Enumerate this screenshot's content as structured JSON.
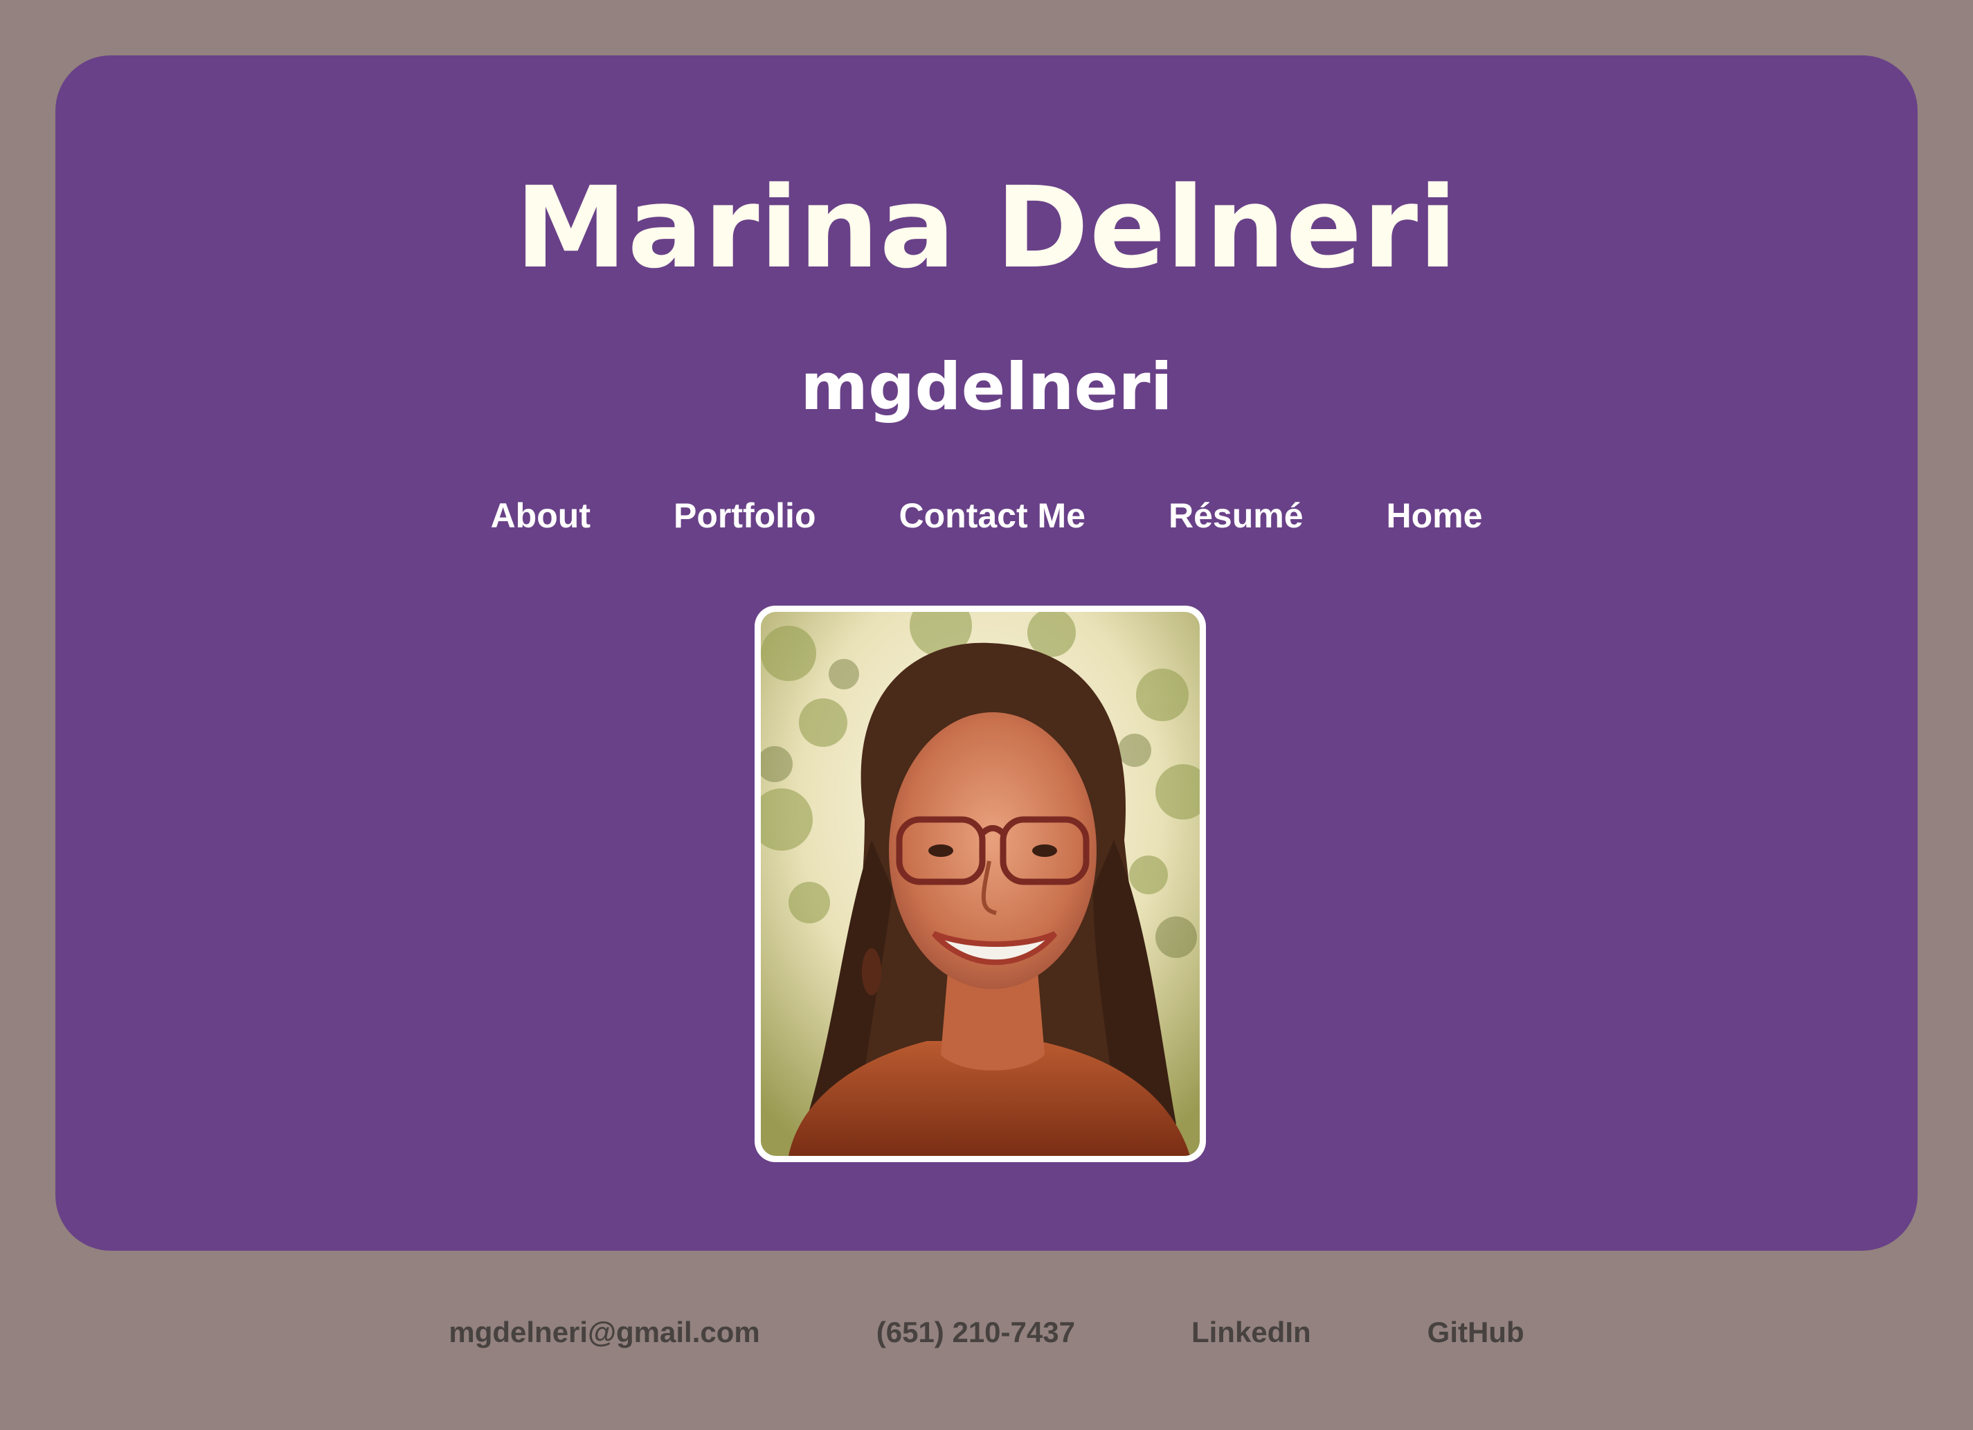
{
  "header": {
    "name": "Marina Delneri",
    "handle": "mgdelneri"
  },
  "nav": {
    "items": [
      {
        "label": "About"
      },
      {
        "label": "Portfolio"
      },
      {
        "label": "Contact Me"
      },
      {
        "label": "Résumé"
      },
      {
        "label": "Home"
      }
    ]
  },
  "profile_photo": {
    "icon": "portrait-photo"
  },
  "footer": {
    "email": "mgdelneri@gmail.com",
    "phone": "(651) 210-7437",
    "linkedin": "LinkedIn",
    "github": "GitHub"
  },
  "colors": {
    "background": "#93827f",
    "card": "#694188",
    "title_text": "#fffdee",
    "nav_text": "#ffffff",
    "footer_text": "#474240"
  }
}
